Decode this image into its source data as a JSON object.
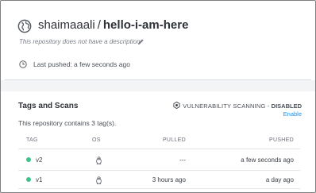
{
  "repo": {
    "owner": "shaimaaali",
    "separator": "/",
    "name": "hello-i-am-here",
    "description": "This repository does not have a description",
    "last_pushed": "Last pushed: a few seconds ago"
  },
  "tags_section": {
    "title": "Tags and Scans",
    "vulnerability_label": "VULNERABILITY SCANNING -",
    "vulnerability_status": "DISABLED",
    "enable_label": "Enable",
    "tag_count_text": "This repository contains 3 tag(s).",
    "columns": {
      "tag": "TAG",
      "os": "OS",
      "pulled": "PULLED",
      "pushed": "PUSHED"
    },
    "rows": [
      {
        "tag": "v2",
        "os": "linux-icon",
        "pulled": "---",
        "pushed": "a few seconds ago"
      },
      {
        "tag": "v1",
        "os": "linux-icon",
        "pulled": "3 hours ago",
        "pushed": "a day ago"
      }
    ]
  },
  "colors": {
    "accent_link": "#1c90ed",
    "status_dot": "#3bc48a"
  }
}
